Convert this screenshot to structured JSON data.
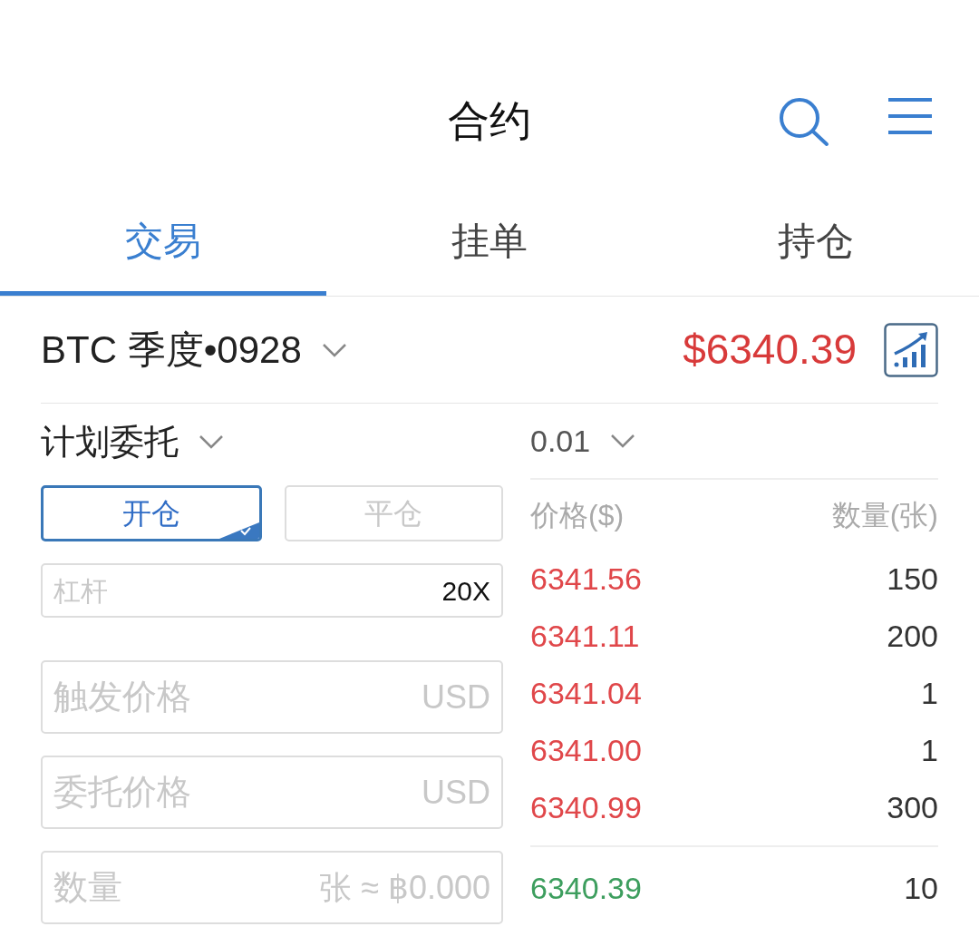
{
  "header": {
    "title": "合约"
  },
  "tabs": [
    {
      "label": "交易",
      "selected": true
    },
    {
      "label": "挂单",
      "selected": false
    },
    {
      "label": "持仓",
      "selected": false
    }
  ],
  "contract": {
    "name": "BTC 季度•0928",
    "price": "$6340.39"
  },
  "order_type": "计划委托",
  "precision": "0.01",
  "modes": [
    {
      "label": "开仓",
      "selected": true
    },
    {
      "label": "平仓",
      "selected": false
    }
  ],
  "leverage": {
    "placeholder": "杠杆",
    "value": "20X"
  },
  "fields": [
    {
      "placeholder": "触发价格",
      "unit": "USD"
    },
    {
      "placeholder": "委托价格",
      "unit": "USD"
    },
    {
      "placeholder": "数量",
      "unit": "张 ≈ ฿0.000"
    }
  ],
  "book": {
    "columns": [
      "价格($)",
      "数量(张)"
    ],
    "asks": [
      {
        "price": "6341.56",
        "amount": "150"
      },
      {
        "price": "6341.11",
        "amount": "200"
      },
      {
        "price": "6341.04",
        "amount": "1"
      },
      {
        "price": "6341.00",
        "amount": "1"
      },
      {
        "price": "6340.99",
        "amount": "300"
      }
    ],
    "bids": [
      {
        "price": "6340.39",
        "amount": "10"
      }
    ]
  }
}
